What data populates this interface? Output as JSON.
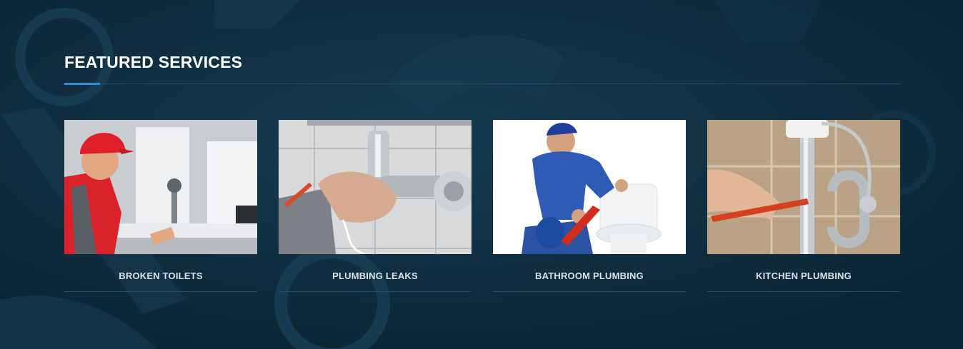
{
  "section": {
    "title": "FEATURED SERVICES",
    "accent_color": "#2f8ed6",
    "background_color": "#0e2a3c"
  },
  "services": [
    {
      "label": "BROKEN TOILETS",
      "photo": "plumber-in-red-cap-at-sink"
    },
    {
      "label": "PLUMBING LEAKS",
      "photo": "hand-fixing-leaking-tap"
    },
    {
      "label": "BATHROOM PLUMBING",
      "photo": "plumber-with-wrench-at-toilet"
    },
    {
      "label": "KITCHEN PLUMBING",
      "photo": "wrench-on-sink-drain-pipe"
    }
  ]
}
